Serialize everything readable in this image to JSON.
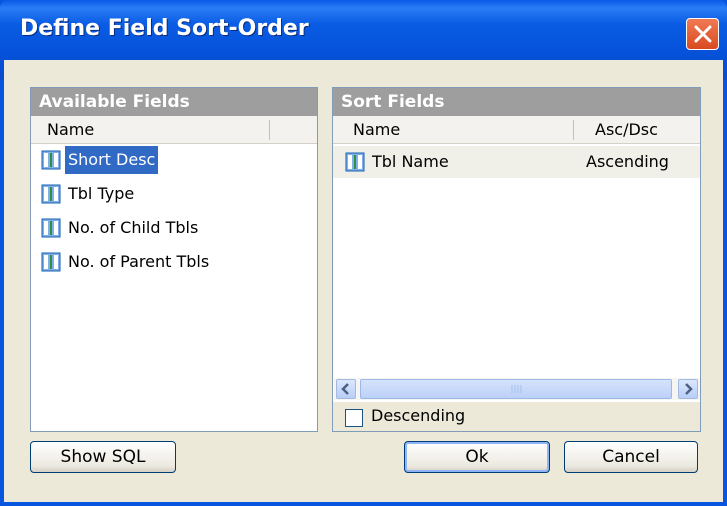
{
  "window": {
    "title": "Define Field Sort-Order",
    "close_icon": "close-icon"
  },
  "available": {
    "header": "Available Fields",
    "column_name": "Name",
    "items": [
      {
        "label": "Short Desc",
        "selected": true
      },
      {
        "label": "Tbl Type"
      },
      {
        "label": "No. of Child Tbls"
      },
      {
        "label": "No. of Parent Tbls"
      }
    ]
  },
  "sort": {
    "header": "Sort Fields",
    "column_name": "Name",
    "column_order": "Asc/Dsc",
    "rows": [
      {
        "name": "Tbl Name",
        "order": "Ascending"
      }
    ],
    "descending_label": "Descending",
    "descending_checked": false
  },
  "buttons": {
    "show_sql": "Show SQL",
    "ok": "Ok",
    "cancel": "Cancel"
  },
  "colors": {
    "title_bar": "#0a55e0",
    "dialog_bg": "#ece9d8",
    "panel_header": "#9e9e9e",
    "selection": "#316ac5"
  }
}
